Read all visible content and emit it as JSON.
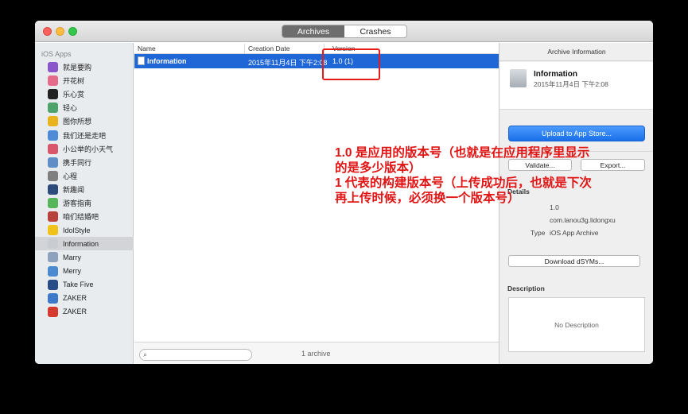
{
  "tabs": {
    "archives": "Archives",
    "crashes": "Crashes"
  },
  "sidebar": {
    "header": "iOS Apps",
    "items": [
      {
        "label": "就是要购",
        "color": "#8a56c9"
      },
      {
        "label": "开花树",
        "color": "#e56b8b"
      },
      {
        "label": "乐心赏",
        "color": "#222222"
      },
      {
        "label": "轻心",
        "color": "#4da36b"
      },
      {
        "label": "图你所想",
        "color": "#e8b31c"
      },
      {
        "label": "我们还是走吧",
        "color": "#4f8bd6"
      },
      {
        "label": "小公举的小天气",
        "color": "#d9556b"
      },
      {
        "label": "携手同行",
        "color": "#5f8ec7"
      },
      {
        "label": "心程",
        "color": "#7f7f7f"
      },
      {
        "label": "新趣闻",
        "color": "#2c4a7a"
      },
      {
        "label": "游客指南",
        "color": "#57b55a"
      },
      {
        "label": "咱们结婚吧",
        "color": "#b8413c"
      },
      {
        "label": "IdolStyle",
        "color": "#f0c21a"
      },
      {
        "label": "Information",
        "color": "#c9ccd1"
      },
      {
        "label": "Marry",
        "color": "#8fa2bd"
      },
      {
        "label": "Merry",
        "color": "#4b89d0"
      },
      {
        "label": "Take Five",
        "color": "#274b84"
      },
      {
        "label": "ZAKER",
        "color": "#3c79c8"
      },
      {
        "label": "ZAKER",
        "color": "#d53a2f"
      }
    ],
    "selected_index": 13
  },
  "list": {
    "columns": {
      "name": "Name",
      "creation_date": "Creation Date",
      "version": "Version"
    },
    "rows": [
      {
        "name": "Information",
        "date": "2015年11月4日 下午2:08",
        "version": "1.0 (1)"
      }
    ],
    "search_glyph": "⌕",
    "count": "1 archive"
  },
  "inspector": {
    "header": "Archive Information",
    "title": "Information",
    "date": "2015年11月4日 下午2:08",
    "upload_label": "Upload to App Store...",
    "validate_label": "Validate...",
    "export_label": "Export...",
    "details_label": "Details",
    "details": {
      "version_value": "1.0",
      "identifier_value": "com.lanou3g.lidongxu",
      "type_label": "Type",
      "type_value": "iOS App Archive"
    },
    "dsyms_label": "Download dSYMs...",
    "description_label": "Description",
    "description_placeholder": "No Description"
  },
  "annotation": {
    "line1": "1.0 是应用的版本号（也就是在应用程序里显示",
    "line2": "的是多少版本）",
    "line3": "1 代表的构建版本号（上传成功后，也就是下次",
    "line4": "再上传时候，必须换一个版本号）",
    "color": "#e11414"
  }
}
